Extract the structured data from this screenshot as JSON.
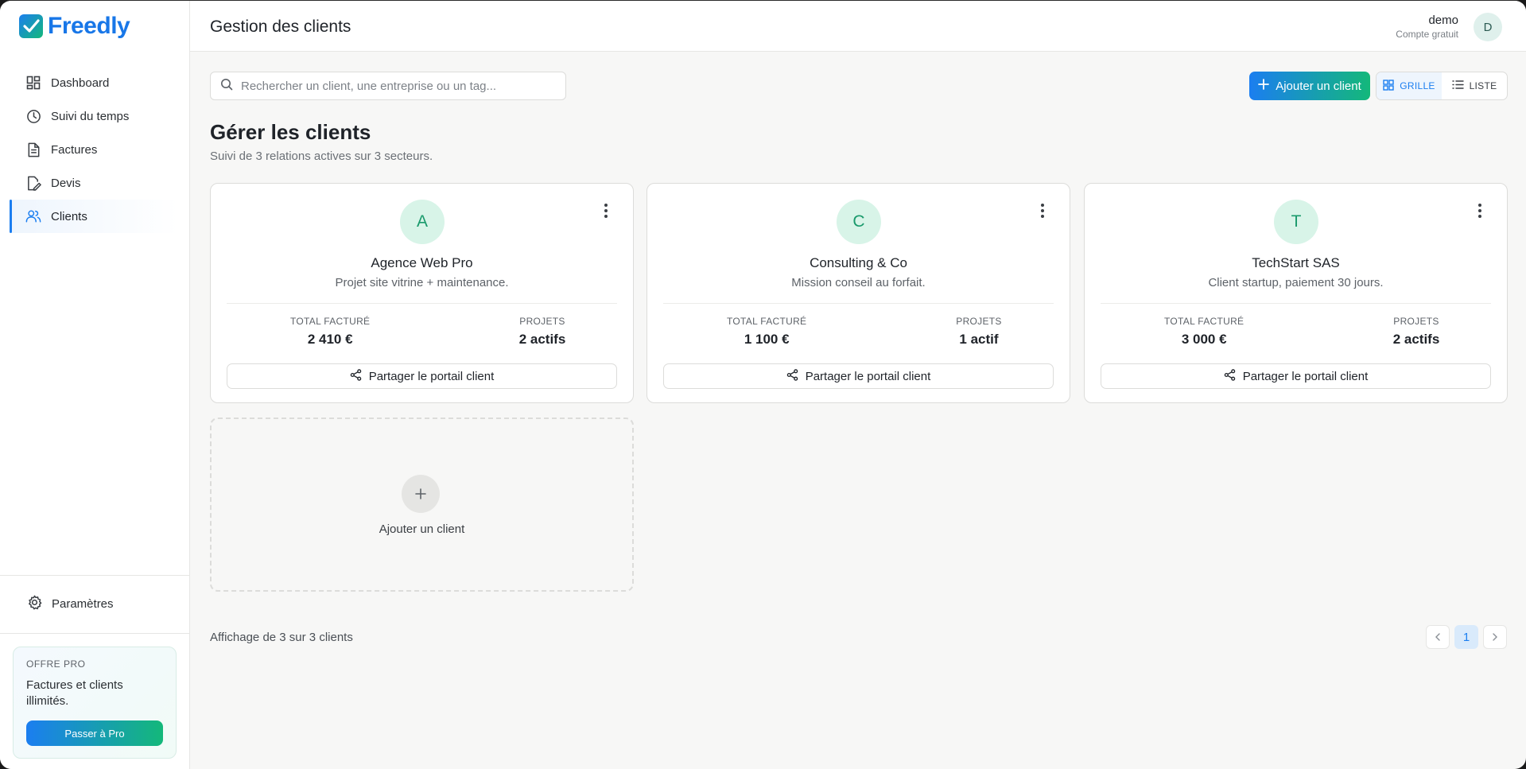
{
  "brand": {
    "name": "Freedly"
  },
  "sidebar": {
    "items": [
      {
        "label": "Dashboard",
        "icon": "grid-icon"
      },
      {
        "label": "Suivi du temps",
        "icon": "clock-icon"
      },
      {
        "label": "Factures",
        "icon": "document-icon"
      },
      {
        "label": "Devis",
        "icon": "edit-document-icon"
      },
      {
        "label": "Clients",
        "icon": "users-icon",
        "active": true
      }
    ],
    "settings_label": "Paramètres",
    "promo": {
      "kicker": "OFFRE PRO",
      "text": "Factures et clients illimités.",
      "button": "Passer à Pro"
    }
  },
  "header": {
    "title": "Gestion des clients",
    "user_name": "demo",
    "user_plan": "Compte gratuit",
    "avatar_initial": "D"
  },
  "toolbar": {
    "search_placeholder": "Rechercher un client, une entreprise ou un tag...",
    "add_label": "Ajouter un client",
    "view_grid": "GRILLE",
    "view_list": "LISTE",
    "active_view": "grid"
  },
  "main": {
    "title": "Gérer les clients",
    "subtitle": "Suivi de 3 relations actives sur 3 secteurs.",
    "stat_billed_label": "TOTAL FACTURÉ",
    "stat_projects_label": "PROJETS",
    "share_label": "Partager le portail client",
    "clients": [
      {
        "initial": "A",
        "name": "Agence Web Pro",
        "desc": "Projet site vitrine + maintenance.",
        "billed": "2 410 €",
        "projects": "2 actifs"
      },
      {
        "initial": "C",
        "name": "Consulting & Co",
        "desc": "Mission conseil au forfait.",
        "billed": "1 100 €",
        "projects": "1 actif"
      },
      {
        "initial": "T",
        "name": "TechStart SAS",
        "desc": "Client startup, paiement 30 jours.",
        "billed": "3 000 €",
        "projects": "2 actifs"
      }
    ],
    "add_card_label": "Ajouter un client"
  },
  "footer": {
    "info": "Affichage de 3 sur 3 clients",
    "current_page": "1"
  },
  "colors": {
    "primary": "#1b7ef0",
    "accent": "#14b87a"
  }
}
